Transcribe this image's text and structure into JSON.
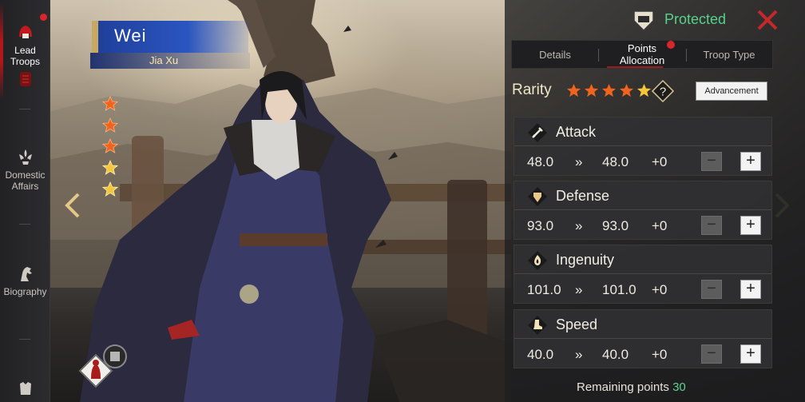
{
  "nav": {
    "items": [
      {
        "label_1": "Lead",
        "label_2": "Troops",
        "icon": "helmet-icon",
        "active": true
      },
      {
        "label_1": "Domestic",
        "label_2": "Affairs",
        "icon": "fleur-icon",
        "active": false
      },
      {
        "label_1": "Biography",
        "label_2": "",
        "icon": "horse-icon",
        "active": false
      },
      {
        "label_1": "",
        "label_2": "",
        "icon": "armor-icon",
        "active": false
      }
    ]
  },
  "hero": {
    "faction": "Wei",
    "name": "Jia Xu",
    "stars": {
      "filled": 3,
      "total": 5
    }
  },
  "header": {
    "status": "Protected",
    "status_color": "#56d18a"
  },
  "tabs": [
    {
      "label_1": "Details",
      "label_2": ""
    },
    {
      "label_1": "Points",
      "label_2": "Allocation"
    },
    {
      "label_1": "Troop Type",
      "label_2": ""
    }
  ],
  "rarity": {
    "label": "Rarity",
    "stars": 5,
    "help": "?",
    "advancement_label": "Advancement"
  },
  "stats": [
    {
      "name": "Attack",
      "icon": "sword-icon",
      "current": "48.0",
      "chevron": "»",
      "new": "48.0",
      "delta": "+0",
      "minus": "−",
      "plus": "+"
    },
    {
      "name": "Defense",
      "icon": "shield-icon",
      "current": "93.0",
      "chevron": "»",
      "new": "93.0",
      "delta": "+0",
      "minus": "−",
      "plus": "+"
    },
    {
      "name": "Ingenuity",
      "icon": "flame-icon",
      "current": "101.0",
      "chevron": "»",
      "new": "101.0",
      "delta": "+0",
      "minus": "−",
      "plus": "+"
    },
    {
      "name": "Speed",
      "icon": "boot-icon",
      "current": "40.0",
      "chevron": "»",
      "new": "40.0",
      "delta": "+0",
      "minus": "−",
      "plus": "+"
    }
  ],
  "remaining": {
    "label": "Remaining points",
    "value": "30"
  },
  "colors": {
    "accent_red": "#d9262a",
    "star_orange": "#f0641e",
    "star_gold": "#f5c53a",
    "green": "#5fd38d"
  }
}
